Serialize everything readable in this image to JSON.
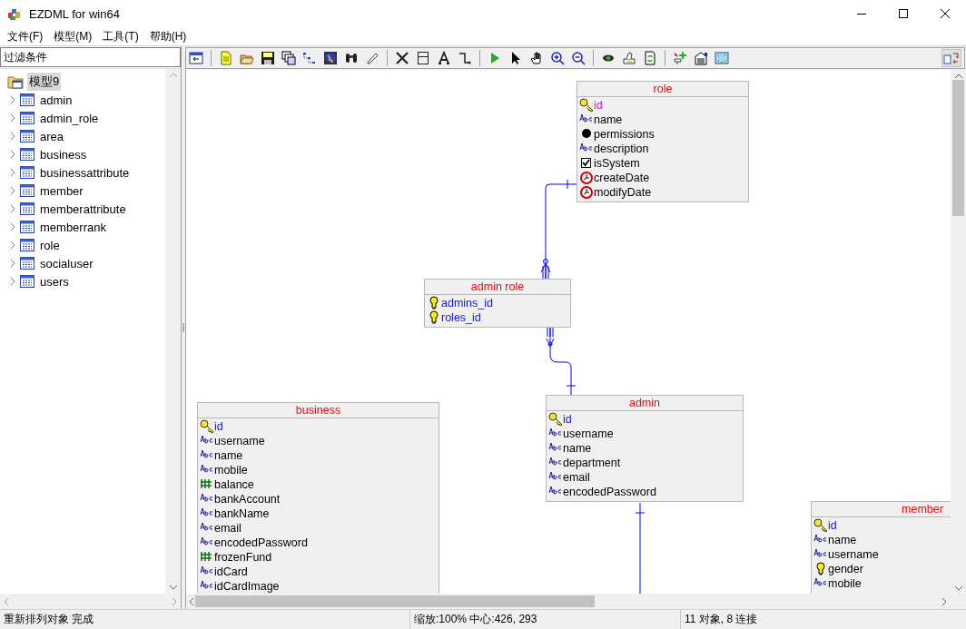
{
  "window": {
    "title": "EZDML for win64"
  },
  "menu": [
    {
      "label": "文件(F)"
    },
    {
      "label": "模型(M)"
    },
    {
      "label": "工具(T)"
    },
    {
      "label": "帮助(H)"
    }
  ],
  "filter": {
    "value": "过滤条件"
  },
  "tree": {
    "label": "模型9",
    "selected": true,
    "children": [
      {
        "label": "admin",
        "expanded": false
      },
      {
        "label": "admin_role",
        "expanded": false
      },
      {
        "label": "area",
        "expanded": false
      },
      {
        "label": "business",
        "expanded": false
      },
      {
        "label": "businessattribute",
        "expanded": false
      },
      {
        "label": "member",
        "expanded": false
      },
      {
        "label": "memberattribute",
        "expanded": false
      },
      {
        "label": "memberrank",
        "expanded": false
      },
      {
        "label": "role",
        "expanded": false
      },
      {
        "label": "socialuser",
        "expanded": false
      },
      {
        "label": "users",
        "expanded": false
      }
    ]
  },
  "entities": [
    {
      "name": "role",
      "fields": [
        {
          "name": "id",
          "kind": "pk",
          "color": "#ff00ff"
        },
        {
          "name": "name",
          "kind": "text"
        },
        {
          "name": "permissions",
          "kind": "object"
        },
        {
          "name": "description",
          "kind": "text"
        },
        {
          "name": "isSystem",
          "kind": "bool"
        },
        {
          "name": "createDate",
          "kind": "date"
        },
        {
          "name": "modifyDate",
          "kind": "date"
        }
      ]
    },
    {
      "name": "admin role",
      "fields": [
        {
          "name": "admins_id",
          "kind": "fk"
        },
        {
          "name": "roles_id",
          "kind": "fk"
        }
      ]
    },
    {
      "name": "business",
      "fields": [
        {
          "name": "id",
          "kind": "pk"
        },
        {
          "name": "username",
          "kind": "text"
        },
        {
          "name": "name",
          "kind": "text"
        },
        {
          "name": "mobile",
          "kind": "text"
        },
        {
          "name": "balance",
          "kind": "number"
        },
        {
          "name": "bankAccount",
          "kind": "text"
        },
        {
          "name": "bankName",
          "kind": "text"
        },
        {
          "name": "email",
          "kind": "text"
        },
        {
          "name": "encodedPassword",
          "kind": "text"
        },
        {
          "name": "frozenFund",
          "kind": "number"
        },
        {
          "name": "idCard",
          "kind": "text"
        },
        {
          "name": "idCardImage",
          "kind": "text"
        }
      ]
    },
    {
      "name": "admin",
      "fields": [
        {
          "name": "id",
          "kind": "pk"
        },
        {
          "name": "username",
          "kind": "text"
        },
        {
          "name": "name",
          "kind": "text"
        },
        {
          "name": "department",
          "kind": "text"
        },
        {
          "name": "email",
          "kind": "text"
        },
        {
          "name": "encodedPassword",
          "kind": "text"
        }
      ]
    },
    {
      "name": "member",
      "fields": [
        {
          "name": "id",
          "kind": "pk"
        },
        {
          "name": "name",
          "kind": "text"
        },
        {
          "name": "username",
          "kind": "text"
        },
        {
          "name": "gender",
          "kind": "fk",
          "color": "#000000"
        },
        {
          "name": "mobile",
          "kind": "text"
        }
      ]
    }
  ],
  "status_bar": [
    "重新排列对象 完成",
    "缩放:100% 中心:426, 293",
    "11 对象, 8 连接"
  ]
}
